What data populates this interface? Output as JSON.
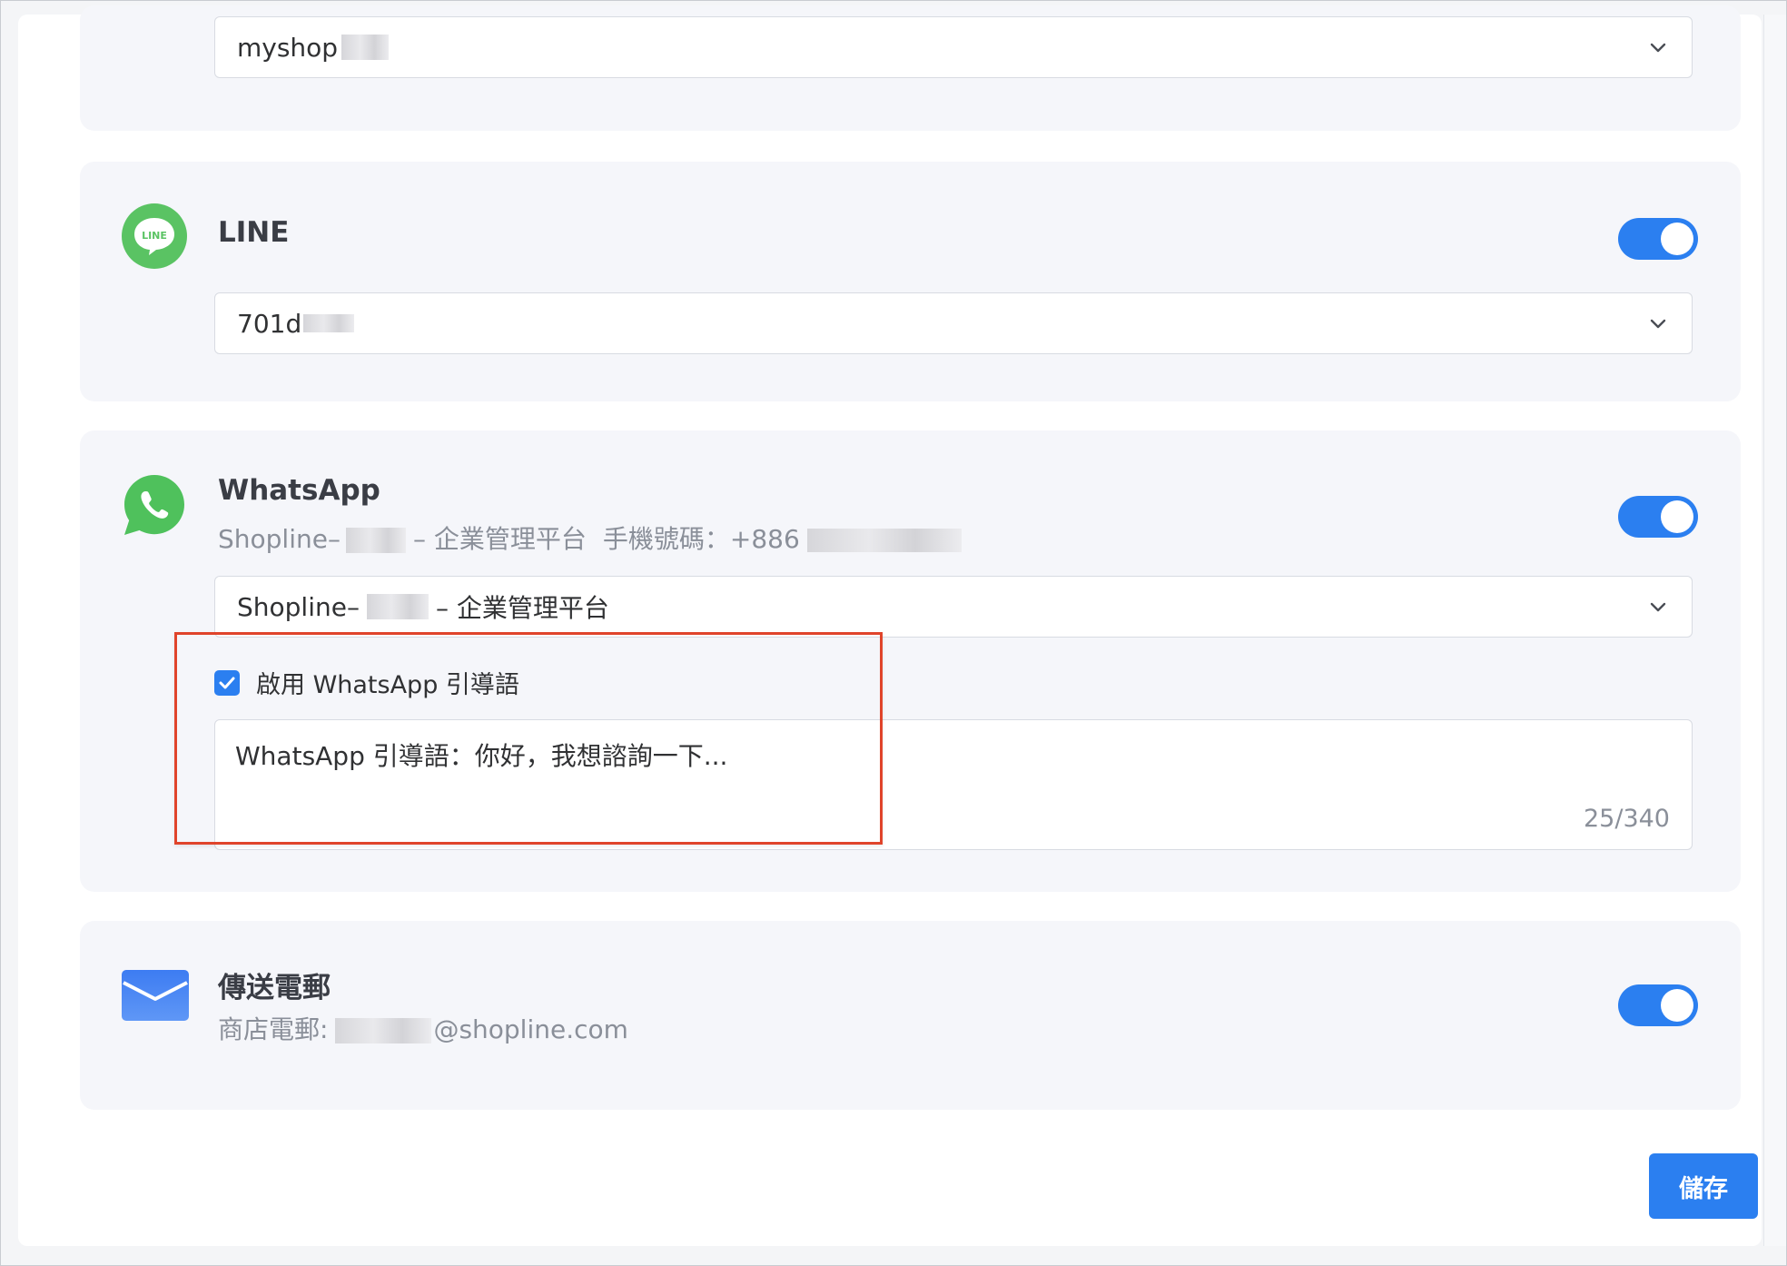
{
  "top_channel": {
    "selected_value": "myshop"
  },
  "line": {
    "title": "LINE",
    "icon_text": "LINE",
    "enabled": true,
    "selected_value": "701d"
  },
  "whatsapp": {
    "title": "WhatsApp",
    "subtitle_prefix": "Shopline–",
    "subtitle_middle": "– 企業管理平台",
    "subtitle_phone_label": "手機號碼：+886",
    "enabled": true,
    "selected_prefix": "Shopline–",
    "selected_suffix": "– 企業管理平台",
    "greeting_checkbox_label": "啟用 WhatsApp 引導語",
    "greeting_checked": true,
    "greeting_text": "WhatsApp 引導語：你好，我想諮詢一下...",
    "greeting_counter": "25/340"
  },
  "email": {
    "title": "傳送電郵",
    "subtitle_label": "商店電郵:",
    "subtitle_domain": "@shopline.com",
    "enabled": true
  },
  "actions": {
    "save_label": "儲存"
  },
  "colors": {
    "accent": "#2b7ff0",
    "line_green": "#5ac363",
    "whatsapp_green": "#4fc15c",
    "highlight_red": "#e0442b"
  }
}
